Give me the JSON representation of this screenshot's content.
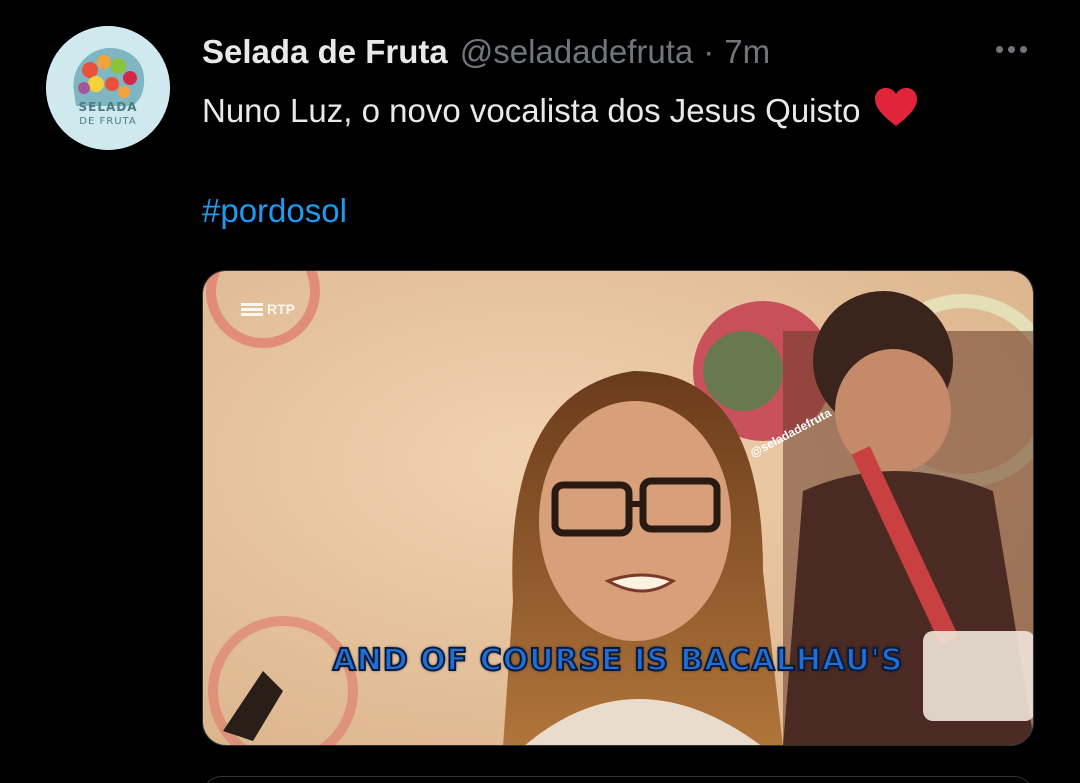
{
  "tweet": {
    "display_name": "Selada de Fruta",
    "handle": "@seladadefruta",
    "separator": "·",
    "time": "7m",
    "text": "Nuno Luz, o novo vocalista dos Jesus Quisto",
    "hashtag": "#pordosol",
    "avatar": {
      "line1": "SELADA",
      "line2": "DE FRUTA"
    },
    "media": {
      "channel_logo": "RTP",
      "watermark": "@seladadefruta",
      "subtitle": "AND OF COURSE IS BACALHAU'S"
    }
  },
  "icons": {
    "heart": "heart-icon",
    "more": "more-options-icon"
  },
  "colors": {
    "background": "#000000",
    "primary_text": "#e7e9ea",
    "secondary_text": "#71767b",
    "link": "#1d9bf0",
    "heart": "#f91880"
  }
}
